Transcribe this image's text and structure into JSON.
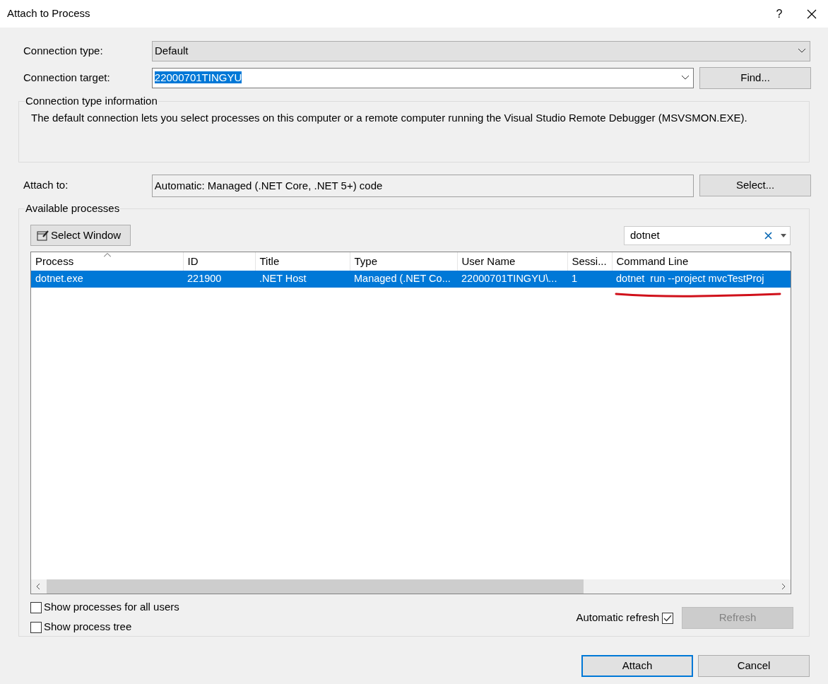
{
  "window": {
    "title": "Attach to Process",
    "help": "?"
  },
  "connection_type": {
    "label": "Connection type:",
    "value": "Default"
  },
  "connection_target": {
    "label": "Connection target:",
    "value": "22000701TINGYU",
    "find_button": "Find..."
  },
  "info": {
    "title": "Connection type information",
    "text": "The default connection lets you select processes on this computer or a remote computer running the Visual Studio Remote Debugger (MSVSMON.EXE)."
  },
  "attach_to": {
    "label": "Attach to:",
    "value": "Automatic: Managed (.NET Core, .NET 5+) code",
    "select_button": "Select..."
  },
  "processes": {
    "title": "Available processes",
    "select_window_button": "Select Window",
    "filter": {
      "value": "dotnet"
    },
    "columns": [
      {
        "label": "Process",
        "sorted": true
      },
      {
        "label": "ID",
        "sorted": false
      },
      {
        "label": "Title",
        "sorted": false
      },
      {
        "label": "Type",
        "sorted": false
      },
      {
        "label": "User Name",
        "sorted": false
      },
      {
        "label": "Sessi...",
        "sorted": false
      },
      {
        "label": "Command Line",
        "sorted": false
      }
    ],
    "rows": [
      {
        "selected": true,
        "cells": [
          {
            "text": "dotnet.exe",
            "underlined": false
          },
          {
            "text": "221900",
            "underlined": false
          },
          {
            "text": ".NET Host",
            "underlined": false
          },
          {
            "text": "Managed (.NET Co...",
            "underlined": false
          },
          {
            "text": "22000701TINGYU\\...",
            "underlined": false
          },
          {
            "text": "1",
            "underlined": false
          },
          {
            "text": "dotnet  run --project mvcTestProj",
            "underlined": true
          }
        ]
      }
    ],
    "options": [
      {
        "label": "Show processes for all users",
        "checked": false
      },
      {
        "label": "Show process tree",
        "checked": false
      }
    ],
    "automatic_refresh": {
      "label": "Automatic refresh",
      "checked": true
    },
    "refresh_button": {
      "label": "Refresh",
      "disabled": true
    }
  },
  "buttons": [
    {
      "label": "Attach",
      "default": true
    },
    {
      "label": "Cancel",
      "default": false
    }
  ]
}
